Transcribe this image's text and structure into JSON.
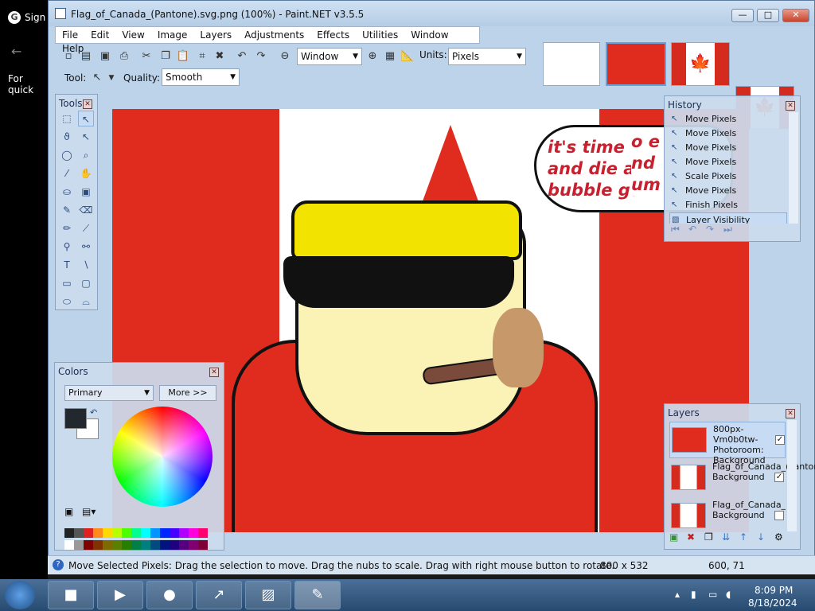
{
  "background": {
    "google_label": "Sign",
    "quick_text": "For quick"
  },
  "window": {
    "title": "Flag_of_Canada_(Pantone).svg.png (100%) - Paint.NET v3.5.5",
    "controls": {
      "minimize": "—",
      "maximize": "□",
      "close": "✕"
    }
  },
  "menu": [
    "File",
    "Edit",
    "View",
    "Image",
    "Layers",
    "Adjustments",
    "Effects",
    "Utilities",
    "Window",
    "Help"
  ],
  "toolbar": {
    "zoom_value": "Window",
    "units_label": "Units:",
    "units_value": "Pixels",
    "tool_label": "Tool:",
    "quality_label": "Quality:",
    "quality_value": "Smooth"
  },
  "canvas": {
    "speech_line1": "it's time t",
    "speech_line2": "and die a",
    "speech_line3": "bubble gu",
    "speech_overlay1": "o e",
    "speech_overlay2": "nd",
    "speech_overlay3": "um"
  },
  "tools_panel": {
    "title": "Tools"
  },
  "history": {
    "title": "History",
    "items": [
      {
        "label": "Move Pixels",
        "selected": false
      },
      {
        "label": "Move Pixels",
        "selected": false
      },
      {
        "label": "Move Pixels",
        "selected": false
      },
      {
        "label": "Move Pixels",
        "selected": false
      },
      {
        "label": "Scale Pixels",
        "selected": false
      },
      {
        "label": "Move Pixels",
        "selected": false
      },
      {
        "label": "Finish Pixels",
        "selected": false
      },
      {
        "label": "Layer Visibility",
        "selected": true
      }
    ]
  },
  "colors": {
    "title": "Colors",
    "mode": "Primary",
    "more_button": "More >>",
    "primary_color": "#23282e",
    "secondary_color": "#ffffff"
  },
  "layers": {
    "title": "Layers",
    "items": [
      {
        "name": "800px-Vm0b0tw-Photoroom: Background",
        "visible": true,
        "selected": true
      },
      {
        "name": "Flag_of_Canada_(Pantone).svg: Background",
        "visible": true,
        "selected": false
      },
      {
        "name": "Flag_of_Canada_(Pantone).svg: Background",
        "visible": false,
        "selected": false
      }
    ]
  },
  "status": {
    "message": "Move Selected Pixels: Drag the selection to move. Drag the nubs to scale. Drag with right mouse button to rotate.",
    "image_size": "800 x 532",
    "cursor_pos": "600, 71"
  },
  "taskbar": {
    "time": "8:09 PM",
    "date": "8/18/2024"
  }
}
